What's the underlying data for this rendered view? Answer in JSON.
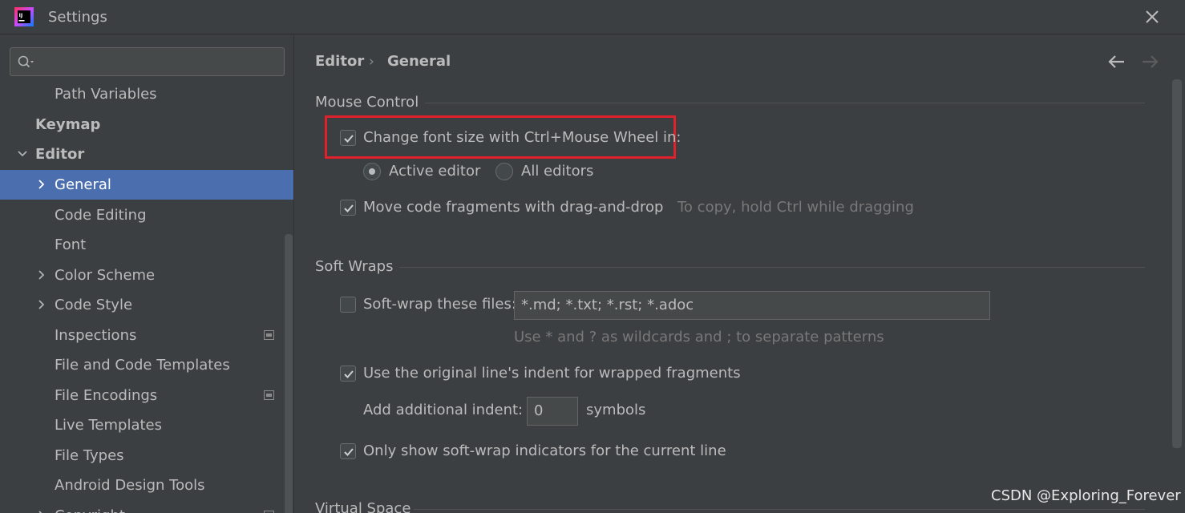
{
  "window": {
    "title": "Settings"
  },
  "sidebar": {
    "search": {
      "value": "",
      "placeholder": ""
    },
    "items": [
      {
        "label": "Path Variables"
      },
      {
        "label": "Keymap"
      },
      {
        "label": "Editor"
      },
      {
        "label": "General"
      },
      {
        "label": "Code Editing"
      },
      {
        "label": "Font"
      },
      {
        "label": "Color Scheme"
      },
      {
        "label": "Code Style"
      },
      {
        "label": "Inspections"
      },
      {
        "label": "File and Code Templates"
      },
      {
        "label": "File Encodings"
      },
      {
        "label": "Live Templates"
      },
      {
        "label": "File Types"
      },
      {
        "label": "Android Design Tools"
      },
      {
        "label": "Copyright"
      }
    ]
  },
  "breadcrumb": {
    "parent": "Editor",
    "separator": "›",
    "current": "General"
  },
  "mouse_control": {
    "title": "Mouse Control",
    "change_font_size": {
      "label": "Change font size with Ctrl+Mouse Wheel in:",
      "checked": true
    },
    "radio_active": {
      "label": "Active editor",
      "selected": true
    },
    "radio_all": {
      "label": "All editors",
      "selected": false
    },
    "move_code": {
      "label": "Move code fragments with drag-and-drop",
      "checked": true,
      "hint": "To copy, hold Ctrl while dragging"
    }
  },
  "soft_wraps": {
    "title": "Soft Wraps",
    "soft_wrap_files": {
      "label": "Soft-wrap these files:",
      "checked": false,
      "value": "*.md; *.txt; *.rst; *.adoc"
    },
    "wildcards_hint": "Use * and ? as wildcards and ; to separate patterns",
    "original_indent": {
      "label": "Use the original line's indent for wrapped fragments",
      "checked": true
    },
    "additional_indent": {
      "label": "Add additional indent:",
      "value": "0",
      "unit": "symbols"
    },
    "indicators": {
      "label": "Only show soft-wrap indicators for the current line",
      "checked": true
    }
  },
  "virtual_space": {
    "title": "Virtual Space"
  },
  "watermark": "CSDN @Exploring_Forever",
  "colors": {
    "selection": "#4b6eaf",
    "highlight_box": "#e0212b",
    "background": "#3c3f41"
  }
}
